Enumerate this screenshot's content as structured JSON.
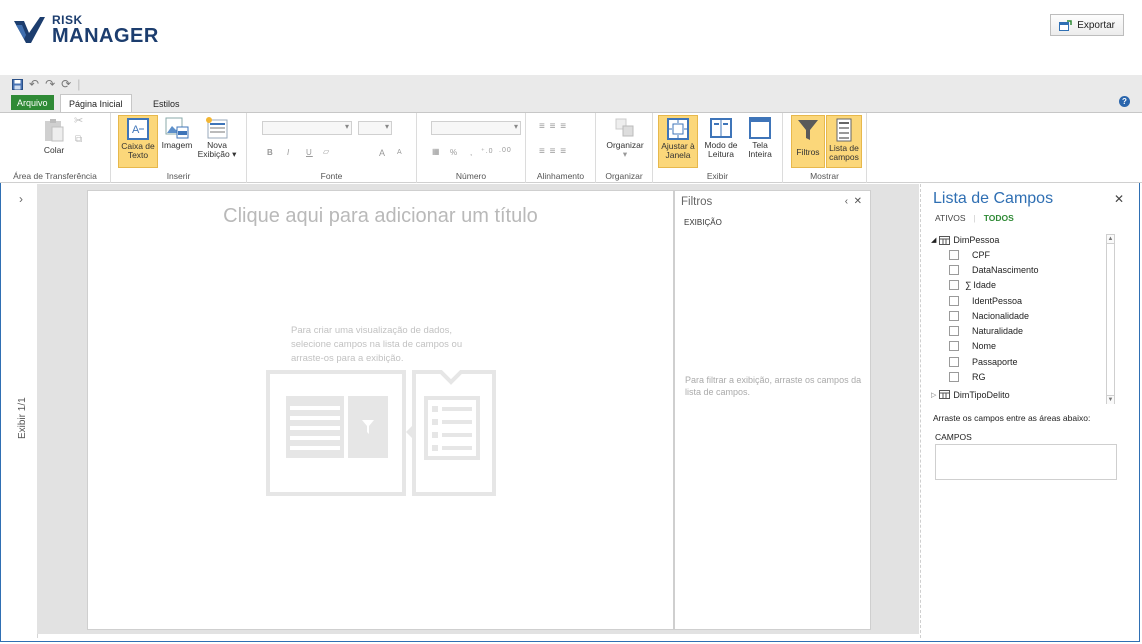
{
  "header": {
    "logo_line1": "RISK",
    "logo_line2": "MANAGER",
    "export_label": "Exportar"
  },
  "tabs": {
    "file": "Arquivo",
    "home": "Página Inicial",
    "styles": "Estilos"
  },
  "ribbon": {
    "clipboard": {
      "paste": "Colar",
      "group": "Área de Transferência"
    },
    "insert": {
      "textbox_line1": "Caixa de",
      "textbox_line2": "Texto",
      "image": "Imagem",
      "newview_line1": "Nova",
      "newview_line2": "Exibição",
      "group": "Inserir"
    },
    "font": {
      "bold": "B",
      "italic": "I",
      "underline": "U",
      "grow": "A",
      "shrink": "A",
      "group": "Fonte"
    },
    "number": {
      "percent": "%",
      "comma": ",",
      "group": "Número"
    },
    "alignment": {
      "group": "Alinhamento"
    },
    "arrange": {
      "organize": "Organizar",
      "group": "Organizar"
    },
    "view": {
      "fit_line1": "Ajustar à",
      "fit_line2": "Janela",
      "read_line1": "Modo de",
      "read_line2": "Leitura",
      "full_line1": "Tela",
      "full_line2": "Inteira",
      "group": "Exibir"
    },
    "show": {
      "filters": "Filtros",
      "fieldlist_line1": "Lista de",
      "fieldlist_line2": "campos",
      "group": "Mostrar"
    }
  },
  "leftbar": {
    "label": "Exibir 1/1"
  },
  "sheet": {
    "title_placeholder": "Clique aqui para adicionar um título",
    "hint": "Para criar uma visualização de dados, selecione campos na lista de campos ou arraste-os para a exibição."
  },
  "filters": {
    "title": "Filtros",
    "subheader": "EXIBIÇÃO",
    "hint": "Para filtrar a exibição, arraste os campos da lista de campos."
  },
  "fieldlist": {
    "title": "Lista de Campos",
    "tab_active": "ATIVOS",
    "tab_all": "TODOS",
    "table1": "DimPessoa",
    "fields": [
      "CPF",
      "DataNascimento",
      "Idade",
      "IdentPessoa",
      "Nacionalidade",
      "Naturalidade",
      "Nome",
      "Passaporte",
      "RG"
    ],
    "table2": "DimTipoDelito",
    "drag_hint": "Arraste os campos entre as áreas abaixo:",
    "fields_area": "CAMPOS"
  },
  "colors": {
    "accent": "#2f6fb3",
    "file_tab": "#2f8a36",
    "highlight": "#fbd77a"
  }
}
